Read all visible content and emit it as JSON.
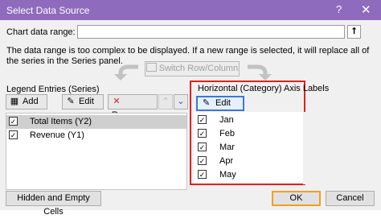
{
  "window": {
    "title": "Select Data Source",
    "help_label": "?",
    "close_label": "✕"
  },
  "range": {
    "label": "Chart data range:",
    "value": "",
    "collapse_glyph": "⭡"
  },
  "message": "The data range is too complex to be displayed. If a new range is selected, it will replace all of the series in the Series panel.",
  "switch_button": "Switch Row/Column",
  "legend": {
    "heading": "Legend Entries (Series)",
    "add_label": "Add",
    "edit_label": "Edit",
    "remove_label": "Remove",
    "items": [
      {
        "label": "Total Items (Y2)",
        "checked": true,
        "selected": true
      },
      {
        "label": "Revenue (Y1)",
        "checked": true,
        "selected": false
      }
    ]
  },
  "axis": {
    "heading": "Horizontal (Category) Axis Labels",
    "edit_label": "Edit",
    "items": [
      {
        "label": "Jan",
        "checked": true
      },
      {
        "label": "Feb",
        "checked": true
      },
      {
        "label": "Mar",
        "checked": true
      },
      {
        "label": "Apr",
        "checked": true
      },
      {
        "label": "May",
        "checked": true
      }
    ]
  },
  "buttons": {
    "hidden_empty": "Hidden and Empty Cells",
    "ok": "OK",
    "cancel": "Cancel"
  },
  "colors": {
    "titlebar": "#8e6bbd",
    "highlight_border": "#e02020",
    "ok_border": "#f0a020"
  }
}
